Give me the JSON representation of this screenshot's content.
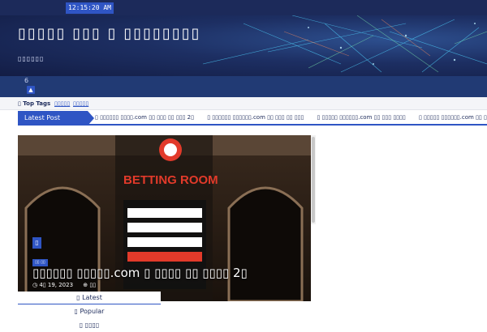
{
  "header": {
    "clock": "12:15:20 AM",
    "site_title": "▯▯▯▯▯ ▯▯▯ ▯ ▯▯▯▯▯▯▯▯",
    "site_tagline": "▯▯▯▯▯▯"
  },
  "nav": {
    "notification_count": "6",
    "bell_icon": "bell-icon"
  },
  "top_tags": {
    "label": "▯ Top Tags",
    "tags": [
      "▯▯▯▯▯",
      "▯▯▯▯▯"
    ]
  },
  "ticker": {
    "label": "Latest Post",
    "items": [
      "▯ ▯▯▯▯▯▯ ▯▯▯▯.com ▯▯ ▯▯▯ ▯▯ ▯▯▯ 2▯",
      "▯ ▯▯▯▯▯▯ ▯▯▯▯▯▯.com ▯▯ ▯▯▯ ▯▯ ▯▯▯",
      "▯ ▯▯▯▯▯ ▯▯▯▯▯▯.com ▯▯ ▯▯▯ ▯▯▯▯",
      "▯ ▯▯▯▯▯ ▯▯▯▯▯▯.com ▯▯ ▯▯▯ ▯▯▯▯",
      "▯ H"
    ]
  },
  "feature": {
    "badge_icon": "▯",
    "category": "▯▯ ▯▯",
    "title": "▯▯▯▯▯▯ ▯▯▯▯▯.com ▯ ▯▯▯▯ ▯▯ ▯▯▯▯ 2▯",
    "date": "◷ 4▯ 19, 2023",
    "author": "⊕ ▯▯"
  },
  "tabs": {
    "latest": "▯ Latest",
    "popular": "▯ Popular",
    "third": "▯ ▯▯▯▯"
  },
  "colors": {
    "brand": "#2f55c4",
    "header_dark": "#1c2a5a",
    "nav": "#213a74"
  }
}
